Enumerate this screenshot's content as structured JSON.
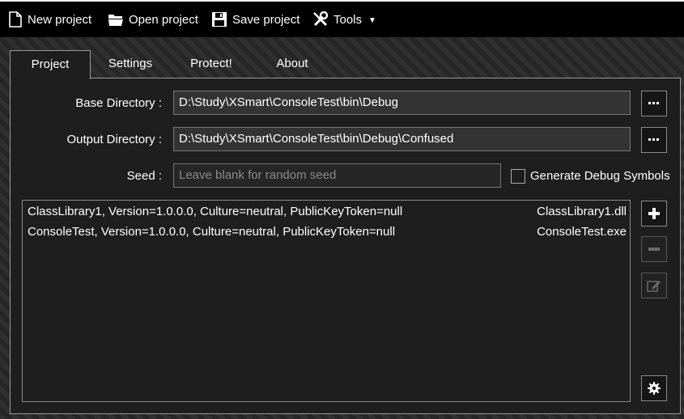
{
  "toolbar": {
    "new_project": "New project",
    "open_project": "Open project",
    "save_project": "Save project",
    "tools": "Tools"
  },
  "tabs": [
    {
      "label": "Project",
      "active": true
    },
    {
      "label": "Settings",
      "active": false
    },
    {
      "label": "Protect!",
      "active": false
    },
    {
      "label": "About",
      "active": false
    }
  ],
  "project": {
    "base_dir_label": "Base Directory :",
    "base_dir_value": "D:\\Study\\XSmart\\ConsoleTest\\bin\\Debug",
    "output_dir_label": "Output Directory :",
    "output_dir_value": "D:\\Study\\XSmart\\ConsoleTest\\bin\\Debug\\Confused",
    "seed_label": "Seed :",
    "seed_placeholder": "Leave blank for random seed",
    "debug_symbols_label": "Generate Debug Symbols",
    "debug_symbols_checked": false,
    "browse_label": "..."
  },
  "modules": [
    {
      "name": "ClassLibrary1, Version=1.0.0.0, Culture=neutral, PublicKeyToken=null",
      "file": "ClassLibrary1.dll"
    },
    {
      "name": "ConsoleTest, Version=1.0.0.0, Culture=neutral, PublicKeyToken=null",
      "file": "ConsoleTest.exe"
    }
  ],
  "side_buttons": {
    "add_icon": "plus-icon",
    "remove_icon": "minus-icon",
    "edit_icon": "edit-icon",
    "settings_icon": "gear-icon"
  }
}
